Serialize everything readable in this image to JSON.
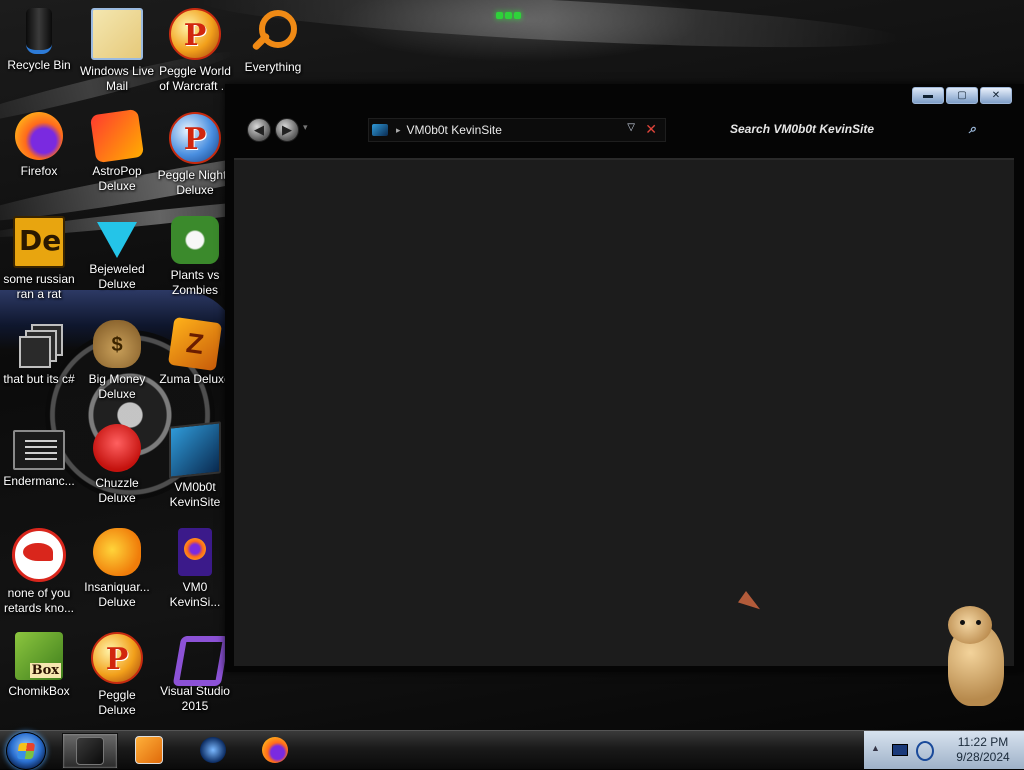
{
  "desktop": {
    "icons": [
      {
        "label": "Recycle Bin",
        "icon": "recycle-bin-icon"
      },
      {
        "label": "Windows Live Mail",
        "icon": "mail-icon"
      },
      {
        "label": "Peggle World of Warcraft ...",
        "icon": "peggle-icon"
      },
      {
        "label": "Everything",
        "icon": "magnifier-icon"
      },
      {
        "label": "Firefox",
        "icon": "firefox-icon"
      },
      {
        "label": "AstroPop Deluxe",
        "icon": "astropop-icon"
      },
      {
        "label": "Peggle Nights Deluxe",
        "icon": "peggle-nights-icon"
      },
      {
        "label": "some russian ran a rat",
        "icon": "de-icon"
      },
      {
        "label": "Bejeweled Deluxe",
        "icon": "gem-icon"
      },
      {
        "label": "Plants vs Zombies",
        "icon": "plant-icon"
      },
      {
        "label": "that but its c#",
        "icon": "stacked-windows-icon"
      },
      {
        "label": "Big Money Deluxe",
        "icon": "money-bag-icon"
      },
      {
        "label": "Zuma Deluxe",
        "icon": "zuma-icon"
      },
      {
        "label": "Endermanc...",
        "icon": "console-icon"
      },
      {
        "label": "Chuzzle Deluxe",
        "icon": "chuzzle-icon"
      },
      {
        "label": "VM0b0t KevinSite",
        "icon": "vm-shortcut-icon"
      },
      {
        "label": "none of you retards kno...",
        "icon": "rat-icon"
      },
      {
        "label": "Insaniquar... Deluxe",
        "icon": "fish-icon"
      },
      {
        "label": "VM0 KevinSi...",
        "icon": "firefox-document-icon"
      },
      {
        "label": "ChomikBox",
        "icon": "hamster-box-icon"
      },
      {
        "label": "Peggle Deluxe",
        "icon": "peggle-icon"
      },
      {
        "label": "Visual Studio 2015",
        "icon": "visual-studio-icon"
      }
    ]
  },
  "window": {
    "controls": {
      "minimize": "▬",
      "maximize": "▢",
      "close": "✕"
    },
    "nav": {
      "back": "◀",
      "forward": "▶",
      "dropdown": "▾"
    },
    "address": {
      "path": "VM0b0t KevinSite",
      "separator": "▸",
      "dropdown": "▽",
      "clear": "✕"
    },
    "search": {
      "placeholder": "Search VM0b0t KevinSite",
      "icon": "⌕"
    }
  },
  "taskbar": {
    "items": [
      "folder-icon",
      "media-player-icon",
      "ie-icon",
      "firefox-icon"
    ],
    "tray": {
      "chevron": "▲",
      "time": "11:22 PM",
      "date": "9/28/2024"
    }
  }
}
